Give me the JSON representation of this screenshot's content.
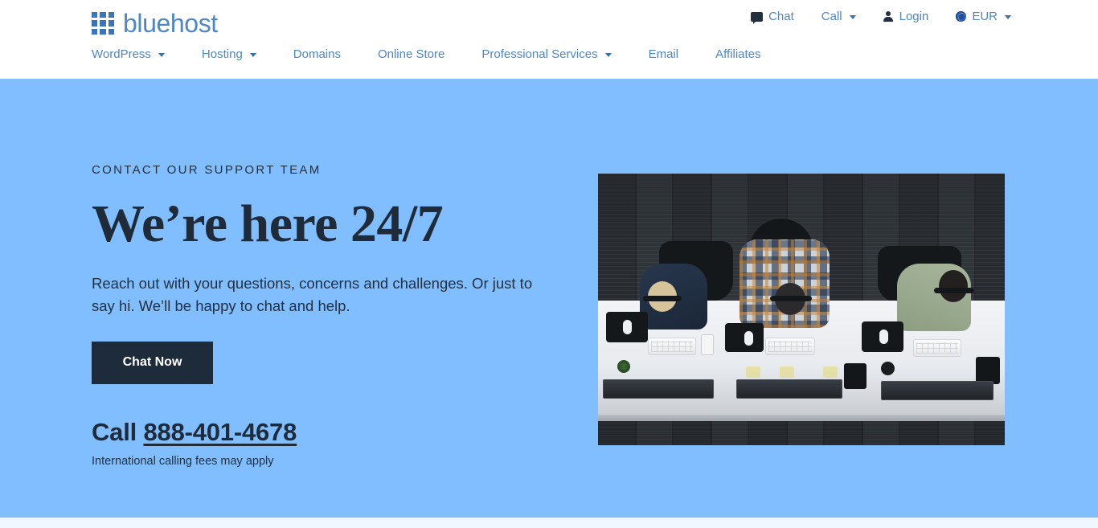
{
  "header": {
    "logo": {
      "icon": "grid-logo-icon",
      "wordmark": "bluehost"
    },
    "utility": [
      {
        "label": "Chat",
        "icon": "chat-bubble-icon",
        "caret": false
      },
      {
        "label": "Call",
        "icon": null,
        "caret": true
      },
      {
        "label": "Login",
        "icon": "person-icon",
        "caret": false
      },
      {
        "label": "EUR",
        "icon": "globe-icon",
        "caret": true
      }
    ],
    "nav": [
      {
        "label": "WordPress",
        "caret": true
      },
      {
        "label": "Hosting",
        "caret": true
      },
      {
        "label": "Domains",
        "caret": false
      },
      {
        "label": "Online Store",
        "caret": false
      },
      {
        "label": "Professional Services",
        "caret": true
      },
      {
        "label": "Email",
        "caret": false
      },
      {
        "label": "Affiliates",
        "caret": false
      }
    ]
  },
  "hero": {
    "eyebrow": "CONTACT OUR SUPPORT TEAM",
    "title": "We’re here 24/7",
    "subtitle": "Reach out with your questions, concerns and challenges. Or just to say hi. We’ll be happy to chat and help.",
    "cta_label": "Chat Now",
    "call_prefix": "Call",
    "phone_number": "888-401-4678",
    "fine_print": "International calling fees may apply",
    "image_alt": "support-team-desk-photo"
  },
  "colors": {
    "hero_background": "#80beff",
    "brand_blue": "#4f86c6",
    "logo_tile": "#3b74b9",
    "dark_navy": "#1e2b3a",
    "heading": "#1f2b38",
    "page_background": "#eff7ff"
  }
}
